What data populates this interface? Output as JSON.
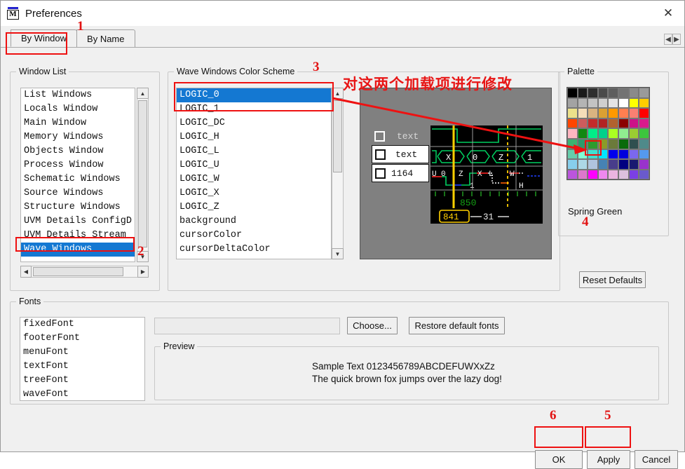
{
  "window": {
    "title": "Preferences",
    "icon": "modelsim-m-icon",
    "close_label": "✕"
  },
  "tabs": [
    {
      "label": "By Window",
      "selected": true
    },
    {
      "label": "By Name",
      "selected": false
    }
  ],
  "tab_nav": {
    "left": "◀",
    "right": "▶"
  },
  "window_list": {
    "legend": "Window List",
    "items": [
      {
        "label": "List Windows",
        "selected": false
      },
      {
        "label": "Locals Window",
        "selected": false
      },
      {
        "label": "Main Window",
        "selected": false
      },
      {
        "label": "Memory Windows",
        "selected": false
      },
      {
        "label": "Objects Window",
        "selected": false
      },
      {
        "label": "Process Window",
        "selected": false
      },
      {
        "label": "Schematic Windows",
        "selected": false
      },
      {
        "label": "Source Windows",
        "selected": false
      },
      {
        "label": "Structure Windows",
        "selected": false
      },
      {
        "label": "UVM Details ConfigD",
        "selected": false
      },
      {
        "label": "UVM Details Stream",
        "selected": false
      },
      {
        "label": "Wave Windows",
        "selected": true
      }
    ]
  },
  "color_scheme": {
    "legend": "Wave Windows Color Scheme",
    "items": [
      {
        "label": "LOGIC_0",
        "selected": true
      },
      {
        "label": "LOGIC_1",
        "selected": false
      },
      {
        "label": "LOGIC_DC",
        "selected": false
      },
      {
        "label": "LOGIC_H",
        "selected": false
      },
      {
        "label": "LOGIC_L",
        "selected": false
      },
      {
        "label": "LOGIC_U",
        "selected": false
      },
      {
        "label": "LOGIC_W",
        "selected": false
      },
      {
        "label": "LOGIC_X",
        "selected": false
      },
      {
        "label": "LOGIC_Z",
        "selected": false
      },
      {
        "label": "background",
        "selected": false
      },
      {
        "label": "cursorColor",
        "selected": false
      },
      {
        "label": "cursorDeltaColor",
        "selected": false
      }
    ]
  },
  "preview": {
    "rows": [
      {
        "checkbox": "unchecked",
        "label": "text",
        "style": "plain"
      },
      {
        "checkbox": "unchecked",
        "label": "text",
        "style": "boxed"
      },
      {
        "checkbox": "unchecked",
        "label": "1164",
        "style": "boxed"
      }
    ],
    "bus_values": [
      "X",
      "0",
      "Z",
      "1"
    ],
    "logic_labels": [
      "U",
      "0",
      "Z",
      "X",
      "L",
      "W",
      "H",
      "1"
    ],
    "time_label": "850",
    "cursor_value": "841",
    "delta_value": "31"
  },
  "palette": {
    "legend": "Palette",
    "selected_name": "Spring Green",
    "selected_index": 34,
    "colors": [
      "#000000",
      "#1a1a1a",
      "#2e2e2e",
      "#4a4a4a",
      "#5e5e5e",
      "#737373",
      "#8a8a8a",
      "#9a9a9a",
      "#a3a3a3",
      "#b4b4b4",
      "#c3c3c3",
      "#cfcfcf",
      "#e4e4e4",
      "#ffffff",
      "#ffff00",
      "#ffcc00",
      "#ece18a",
      "#f5ddb8",
      "#d9b380",
      "#dba032",
      "#ff9900",
      "#ff7f50",
      "#fa8072",
      "#ff0000",
      "#ff4500",
      "#cd5c5c",
      "#c42b2b",
      "#b22222",
      "#b2622f",
      "#8b0000",
      "#cc1188",
      "#d81b8c",
      "#ffb6c1",
      "#118811",
      "#00ee88",
      "#00d18a",
      "#aaff22",
      "#90ee90",
      "#9acd32",
      "#3dc63d",
      "#3cb371",
      "#2e9b6b",
      "#2e9b2e",
      "#8a9b28",
      "#6b7a3a",
      "#0a6b0a",
      "#2f4f4f",
      "#4f8a8a",
      "#66cdaa",
      "#7fffd4",
      "#40e0d0",
      "#00e5ff",
      "#0000ee",
      "#0000dd",
      "#7b68ee",
      "#5599ee",
      "#87ceeb",
      "#add8e6",
      "#b0c4de",
      "#4682b4",
      "#483d8b",
      "#000080",
      "#191970",
      "#9932cc",
      "#bb55dd",
      "#dd77cc",
      "#ff00ff",
      "#ee88ee",
      "#ebb4e0",
      "#ddc0dd",
      "#7b3fe4",
      "#6a5acd"
    ]
  },
  "reset_defaults": {
    "label": "Reset Defaults"
  },
  "fonts": {
    "legend": "Fonts",
    "items": [
      "fixedFont",
      "footerFont",
      "menuFont",
      "textFont",
      "treeFont",
      "waveFont"
    ],
    "field_value": "",
    "choose_label": "Choose...",
    "restore_label": "Restore default fonts",
    "preview": {
      "legend": "Preview",
      "line1": "Sample Text 0123456789ABCDEFUWXxZz",
      "line2": "The quick brown fox jumps over the lazy dog!"
    }
  },
  "buttons": {
    "ok": "OK",
    "apply": "Apply",
    "cancel": "Cancel"
  },
  "annotations": {
    "chinese_note": "对这两个加载项进行修改",
    "marks": [
      "1",
      "2",
      "3",
      "4",
      "5",
      "6"
    ],
    "color": "#ee1111"
  }
}
